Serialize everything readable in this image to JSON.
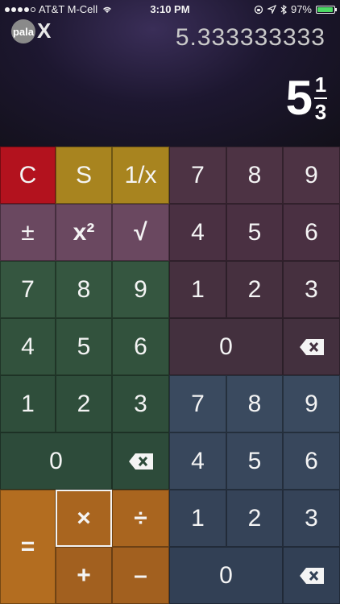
{
  "status": {
    "carrier": "AT&T M-Cell",
    "time": "3:10 PM",
    "battery": "97%",
    "battery_level": 0.97
  },
  "header": {
    "avatar_text": "pala",
    "close_label": "X"
  },
  "display": {
    "decimal": "5.333333333",
    "whole": "5",
    "numerator": "1",
    "denominator": "3"
  },
  "colors": {
    "red": "#b3121e",
    "gold": "#a8841f",
    "mauve_dark": "#4d3344",
    "mauve": "#6a4860",
    "green": "#355640",
    "green_dark": "#2d4b3a",
    "orange": "#b36d20",
    "blue_gray": "#38475c"
  },
  "keys": {
    "clear": "C",
    "store": "S",
    "reciprocal": "1/x",
    "plus_minus": "±",
    "square": "x²",
    "sqrt": "√",
    "equals": "=",
    "multiply": "×",
    "divide": "÷",
    "add": "+",
    "subtract": "–",
    "pad1": {
      "r1": [
        "7",
        "8",
        "9"
      ],
      "r2": [
        "4",
        "5",
        "6"
      ],
      "r3": [
        "1",
        "2",
        "3"
      ],
      "zero": "0"
    },
    "pad2": {
      "r1": [
        "7",
        "8",
        "9"
      ],
      "r2": [
        "4",
        "5",
        "6"
      ],
      "r3": [
        "1",
        "2",
        "3"
      ],
      "zero": "0"
    },
    "pad3": {
      "r1": [
        "7",
        "8",
        "9"
      ],
      "r2": [
        "4",
        "5",
        "6"
      ],
      "r3": [
        "1",
        "2",
        "3"
      ],
      "zero": "0"
    }
  }
}
